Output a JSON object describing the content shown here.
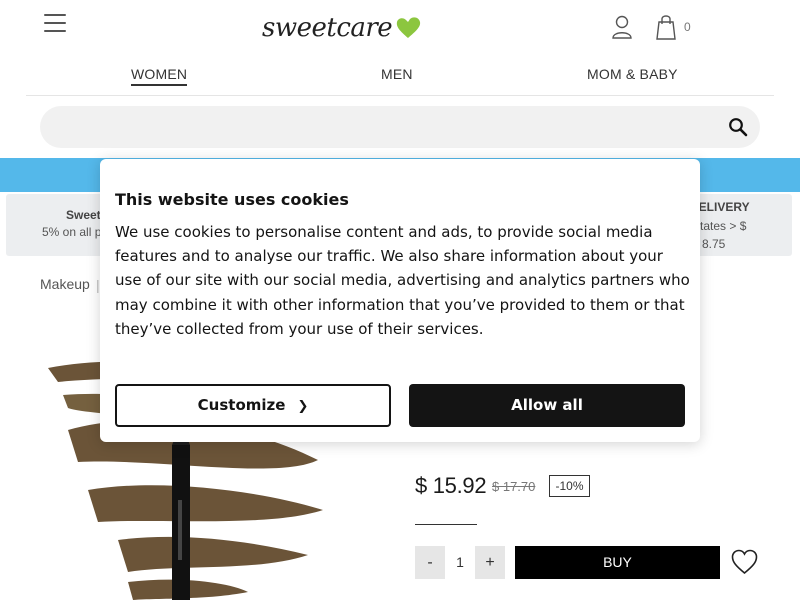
{
  "header": {
    "logo_text": "sweetcare",
    "cart_count": "0",
    "brand_color": "#8cc63f"
  },
  "nav": {
    "tabs": [
      {
        "label": "WOMEN",
        "active": true
      },
      {
        "label": "MEN",
        "active": false
      },
      {
        "label": "MOM & BABY",
        "active": false
      }
    ]
  },
  "search": {
    "placeholder": "",
    "value": ""
  },
  "promo": {
    "color": "#54b8ea"
  },
  "info_boxes": {
    "left_title": "Sweet",
    "left_text": "5% on all p",
    "right_title": "DELIVERY",
    "right_text_1": "ted States > $",
    "right_text_2": "8.75"
  },
  "breadcrumb": {
    "first": "Makeup",
    "separator": "|"
  },
  "product": {
    "stray_char": ")",
    "price": "$ 15.92",
    "old_price": "$ 17.70",
    "discount": "-10%",
    "qty_minus": "-",
    "qty_value": "1",
    "qty_plus": "+",
    "buy_label": "BUY"
  },
  "cookie": {
    "title": "This website uses cookies",
    "text": "We use cookies to personalise content and ads, to provide social media features and to analyse our traffic. We also share information about your use of our site with our social media, advertising and analytics partners who may combine it with other information that you’ve provided to them or that they’ve collected from your use of their services.",
    "customize_label": "Customize",
    "allow_label": "Allow all"
  },
  "icons": {
    "menu": "hamburger-menu-icon",
    "user": "user-icon",
    "bag": "shopping-bag-icon",
    "search": "search-icon",
    "wishlist": "heart-icon",
    "chevron": "chevron-right-icon"
  }
}
